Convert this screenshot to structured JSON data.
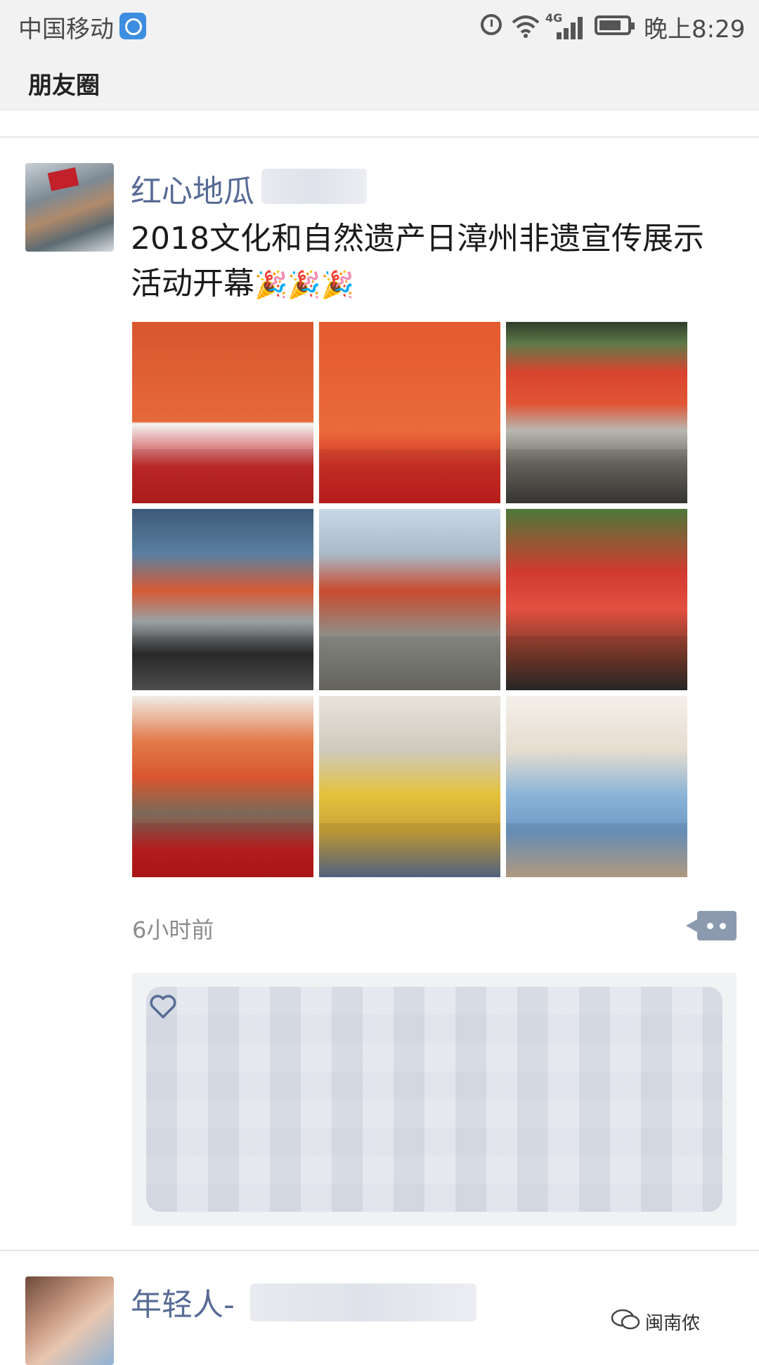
{
  "status_bar": {
    "carrier": "中国移动",
    "network": "4G",
    "time": "晚上8:29"
  },
  "nav": {
    "title": "朋友圈"
  },
  "posts": [
    {
      "name": "红心地瓜",
      "text": "2018文化和自然遗产日漳州非遗宣传展示活动开幕",
      "emoji": "🎉🎉🎉",
      "photo_count": 9,
      "time_ago": "6小时前"
    },
    {
      "name": "年轻人-"
    }
  ],
  "watermark": {
    "text": "闽南侬"
  }
}
